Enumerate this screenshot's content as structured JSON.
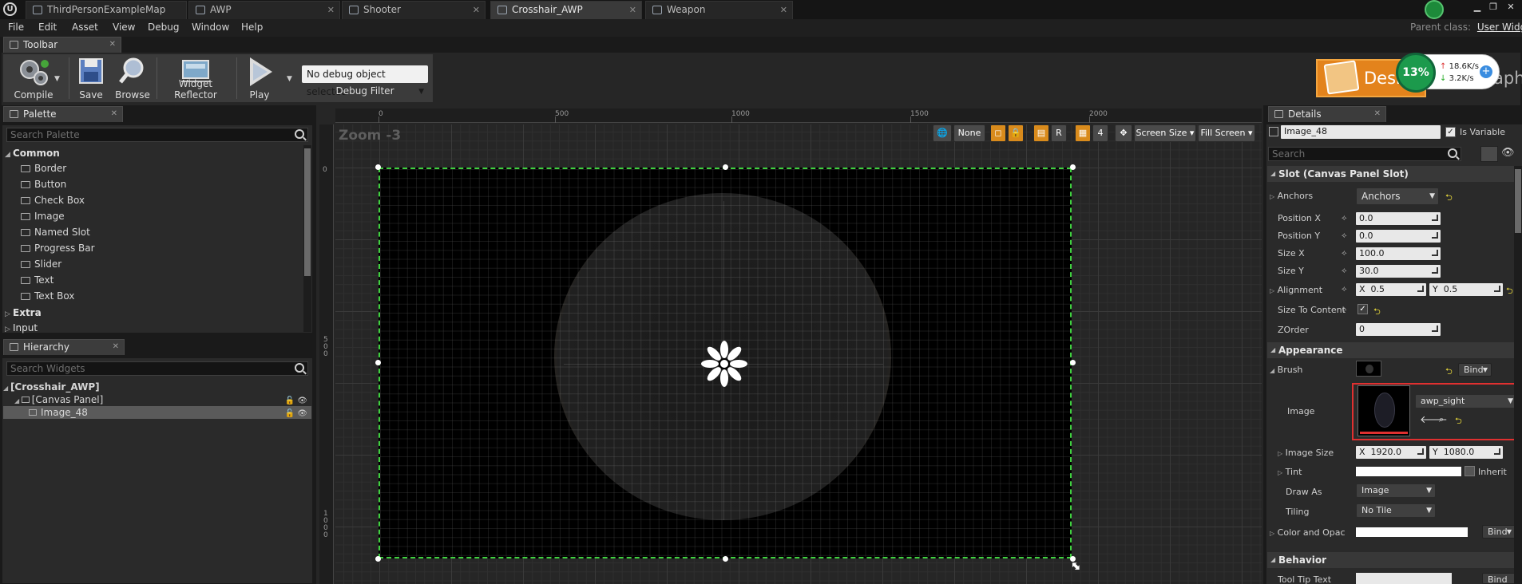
{
  "document_tabs": [
    {
      "label": "ThirdPersonExampleMap"
    },
    {
      "label": "AWP"
    },
    {
      "label": "Shooter"
    },
    {
      "label": "Crosshair_AWP"
    },
    {
      "label": "Weapon"
    }
  ],
  "menu": {
    "items": [
      "File",
      "Edit",
      "Asset",
      "View",
      "Debug",
      "Window",
      "Help"
    ],
    "parent_class_label": "Parent class:",
    "parent_class_value": "User Widget"
  },
  "toolbar": {
    "tab_label": "Toolbar",
    "compile_label": "Compile",
    "save_label": "Save",
    "browse_label": "Browse",
    "widget_reflector_label": "Widget Reflector",
    "play_label": "Play",
    "debug_object": "No debug object selected",
    "debug_filter_label": "Debug Filter"
  },
  "mode": {
    "designer_label": "Designer",
    "graph_label": "aph"
  },
  "speed_widget": {
    "percent": "13%",
    "up": "18.6K/s",
    "down": "3.2K/s",
    "plus": "+"
  },
  "palette": {
    "tab_label": "Palette",
    "search_placeholder": "Search Palette",
    "categories": [
      {
        "name": "Common",
        "expanded": true
      },
      {
        "name": "Extra",
        "expanded": false
      },
      {
        "name": "Input",
        "expanded": false
      }
    ],
    "common_items": [
      "Border",
      "Button",
      "Check Box",
      "Image",
      "Named Slot",
      "Progress Bar",
      "Slider",
      "Text",
      "Text Box"
    ]
  },
  "hierarchy": {
    "tab_label": "Hierarchy",
    "search_placeholder": "Search Widgets",
    "rows": [
      "[Crosshair_AWP]",
      "[Canvas Panel]",
      "Image_48"
    ]
  },
  "canvas": {
    "zoom": "Zoom -3",
    "ruler_top": [
      "0",
      "500",
      "1000",
      "1500",
      "2000"
    ],
    "ruler_left": [
      "0",
      "5 0 0",
      "1 0 0 0"
    ],
    "buttons": {
      "none_label": "None",
      "r_label": "R",
      "grid_value": "4",
      "screen_size_label": "Screen Size",
      "fill_screen_label": "Fill Screen"
    }
  },
  "details": {
    "tab_label": "Details",
    "widget_name": "Image_48",
    "is_variable_label": "Is Variable",
    "is_variable": true,
    "search_placeholder": "Search",
    "slot_section": "Slot (Canvas Panel Slot)",
    "anchors_label": "Anchors",
    "anchors_value": "Anchors",
    "position_x_label": "Position X",
    "position_x": "0.0",
    "position_y_label": "Position Y",
    "position_y": "0.0",
    "size_x_label": "Size X",
    "size_x": "100.0",
    "size_y_label": "Size Y",
    "size_y": "30.0",
    "alignment_label": "Alignment",
    "alignment_x": "0.5",
    "alignment_y": "0.5",
    "x_prefix": "X",
    "y_prefix": "Y",
    "size_to_content_label": "Size To Content",
    "size_to_content": true,
    "zorder_label": "ZOrder",
    "zorder": "0",
    "appearance_section": "Appearance",
    "brush_label": "Brush",
    "bind_label": "Bind",
    "image_label": "Image",
    "image_asset": "awp_sight",
    "image_size_label": "Image Size",
    "image_size_x": "1920.0",
    "image_size_y": "1080.0",
    "tint_label": "Tint",
    "inherit_label": "Inherit",
    "draw_as_label": "Draw As",
    "draw_as_value": "Image",
    "tiling_label": "Tiling",
    "tiling_value": "No Tile",
    "color_label": "Color and Opac",
    "behavior_section": "Behavior",
    "tooltip_label": "Tool Tip Text"
  },
  "colors": {
    "selection_green": "#3fd13f",
    "accent_orange": "#e3831c",
    "highlight_red": "#e03030"
  }
}
